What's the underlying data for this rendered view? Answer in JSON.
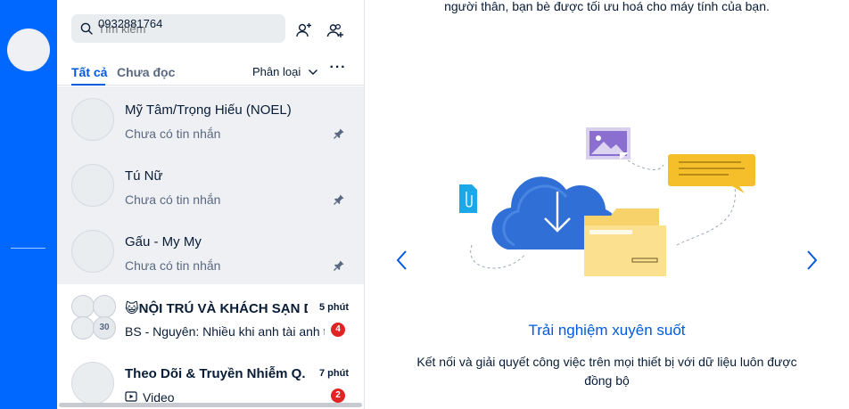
{
  "search": {
    "placeholder": "Tìm kiếm",
    "value": "0932881764"
  },
  "filters": {
    "all": "Tất cả",
    "unread": "Chưa đọc",
    "classify": "Phân loại",
    "more": "···"
  },
  "conversations": [
    {
      "name": "Mỹ Tâm/Trọng Hiếu (NOEL)",
      "preview": "Chưa có tin nhắn",
      "pinned": true
    },
    {
      "name": "Tú Nữ",
      "preview": "Chưa có tin nhắn",
      "pinned": true
    },
    {
      "name": "Gấu - My My",
      "preview": "Chưa có tin nhắn",
      "pinned": true
    },
    {
      "name": "😺NỘI TRÚ VÀ KHÁCH SẠN DL",
      "preview": "BS - Nguyên: Nhiều khi anh tài anh tính",
      "time": "5 phút",
      "badge": "4",
      "member_count": "30"
    },
    {
      "name": "Theo Dõi & Truyền Nhiễm Q.",
      "preview": "Video",
      "time": "7 phút",
      "badge": "2"
    }
  ],
  "welcome": {
    "top_text": "người thân, bạn bè được tối ưu hoá cho máy tính của bạn.",
    "slide_title": "Trải nghiệm xuyên suốt",
    "slide_desc": "Kết nối và giải quyết công việc trên mọi thiết bị với dữ liệu luôn được đồng bộ"
  },
  "colors": {
    "rail": "#0068ff",
    "accent": "#005ae0",
    "badge": "#e02424"
  }
}
